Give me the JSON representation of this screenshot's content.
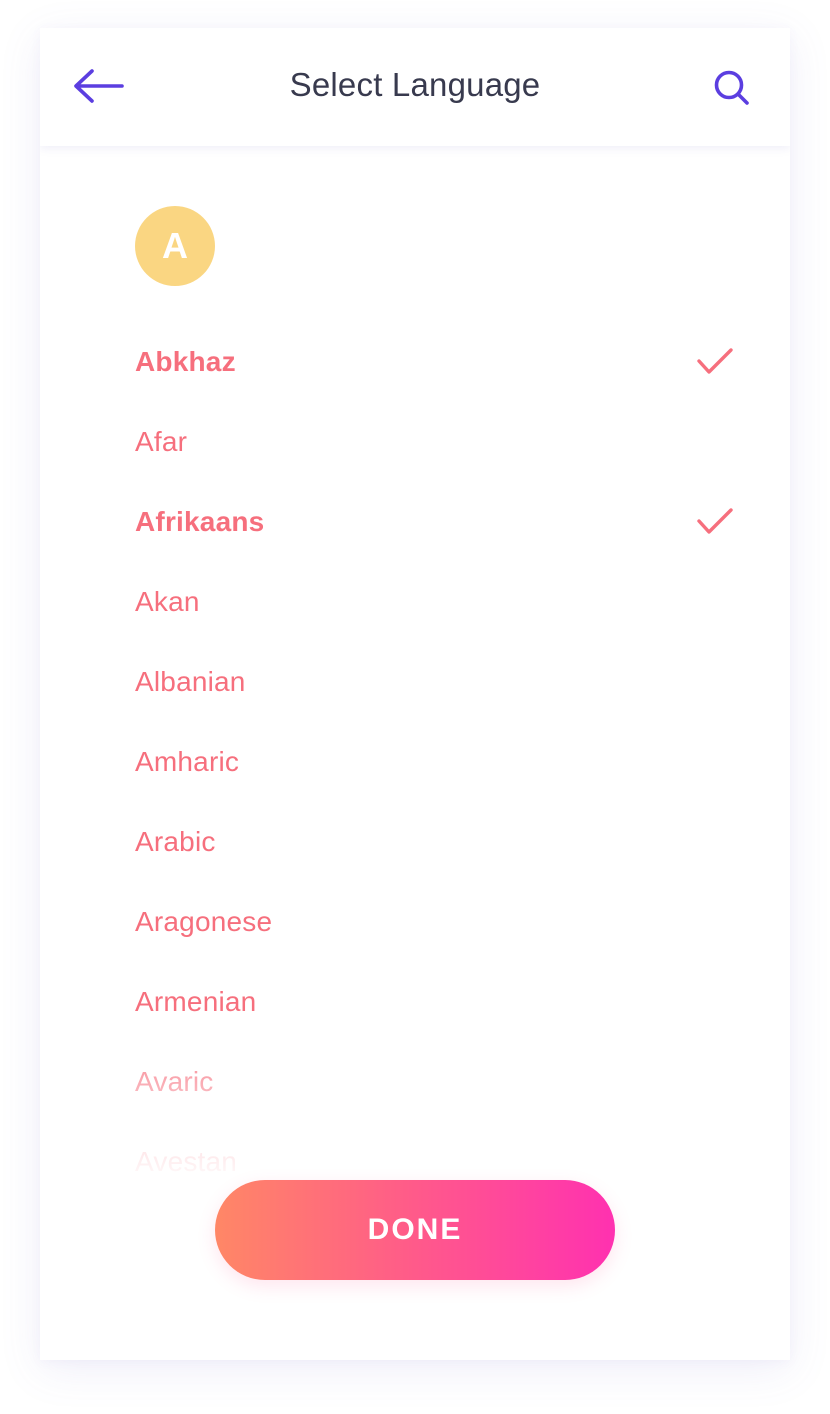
{
  "colors": {
    "accent": "#5b3ee0",
    "title_text": "#383a4e",
    "language_text": "#f66f7d",
    "badge_background": "#fad682",
    "done_gradient_start": "#ff8766",
    "done_gradient_end": "#ff31b0"
  },
  "header": {
    "title": "Select Language",
    "back_icon": "arrow-left-icon",
    "search_icon": "search-icon"
  },
  "section": {
    "letter": "A"
  },
  "languages": [
    {
      "label": "Abkhaz",
      "selected": true
    },
    {
      "label": "Afar",
      "selected": false
    },
    {
      "label": "Afrikaans",
      "selected": true
    },
    {
      "label": "Akan",
      "selected": false
    },
    {
      "label": "Albanian",
      "selected": false
    },
    {
      "label": "Amharic",
      "selected": false
    },
    {
      "label": "Arabic",
      "selected": false
    },
    {
      "label": "Aragonese",
      "selected": false
    },
    {
      "label": "Armenian",
      "selected": false
    },
    {
      "label": "Avaric",
      "selected": false
    },
    {
      "label": "Avestan",
      "selected": false
    }
  ],
  "footer": {
    "done_label": "DONE"
  }
}
